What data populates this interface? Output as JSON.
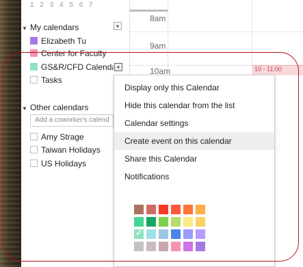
{
  "mini_calendar": {
    "day_numbers": "1 2 3 4 5 6 7"
  },
  "my_calendars": {
    "title": "My calendars",
    "items": [
      {
        "label": "Elizabeth Tu",
        "color": "#a47ae2"
      },
      {
        "label": "Center for Faculty",
        "color": "#f691b2"
      },
      {
        "label": "GS&R/CFD Calenda",
        "color": "#92e1c0"
      },
      {
        "label": "Tasks",
        "color": ""
      }
    ]
  },
  "other_calendars": {
    "title": "Other calendars",
    "add_placeholder": "Add a coworker's calend",
    "items": [
      {
        "label": "Amy Strage"
      },
      {
        "label": "Taiwan Holidays"
      },
      {
        "label": "US Holidays"
      }
    ]
  },
  "time_grid": {
    "hours": [
      "8am",
      "9am",
      "10am"
    ],
    "event_label": "10 - 11:00"
  },
  "context_menu": {
    "items": [
      "Display only this Calendar",
      "Hide this calendar from the list",
      "Calendar settings",
      "Create event on this calendar",
      "Share this Calendar",
      "Notifications"
    ],
    "highlighted_index": 3,
    "palette": [
      [
        "#ac725e",
        "#d06b64",
        "#f83a22",
        "#fa573c",
        "#ff7537",
        "#ffad46"
      ],
      [
        "#42d692",
        "#16a765",
        "#7bd148",
        "#b3dc6c",
        "#fbe983",
        "#fad165"
      ],
      [
        "#92e1c0",
        "#9fe1e7",
        "#9fc6e7",
        "#4986e7",
        "#9a9cff",
        "#b99aff"
      ],
      [
        "#c2c2c2",
        "#cabdbf",
        "#cca6ac",
        "#f691b2",
        "#cd74e6",
        "#a47ae2"
      ]
    ],
    "selected_color": "#92e1c0",
    "check_glyph": "✓"
  },
  "icons": {
    "expand": "▼",
    "dropdown": "▾"
  },
  "annotation_color": "#b0131b"
}
